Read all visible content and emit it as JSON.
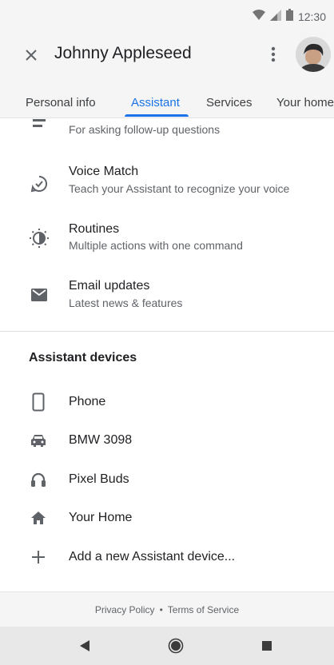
{
  "status_bar": {
    "time": "12:30",
    "icons": [
      "wifi-icon",
      "signal-icon",
      "battery-icon"
    ]
  },
  "header": {
    "title": "Johnny Appleseed",
    "close_icon": "close-icon",
    "menu_icon": "more-vert-icon"
  },
  "tabs": [
    {
      "label": "Personal info",
      "active": false
    },
    {
      "label": "Assistant",
      "active": true
    },
    {
      "label": "Services",
      "active": false
    },
    {
      "label": "Your home",
      "active": false
    }
  ],
  "settings": [
    {
      "title": "",
      "subtitle": "For asking follow-up questions",
      "icon": "conversation-icon"
    },
    {
      "title": "Voice Match",
      "subtitle": "Teach your Assistant to recognize your voice",
      "icon": "voice-match-icon"
    },
    {
      "title": "Routines",
      "subtitle": "Multiple actions with one command",
      "icon": "routines-icon"
    },
    {
      "title": "Email updates",
      "subtitle": "Latest news & features",
      "icon": "email-icon"
    }
  ],
  "devices": {
    "section_title": "Assistant devices",
    "items": [
      {
        "label": "Phone",
        "icon": "phone-icon"
      },
      {
        "label": "BMW 3098",
        "icon": "car-icon"
      },
      {
        "label": "Pixel Buds",
        "icon": "headphones-icon"
      },
      {
        "label": "Your Home",
        "icon": "home-icon"
      },
      {
        "label": "Add a new Assistant device...",
        "icon": "add-icon"
      }
    ]
  },
  "footer": {
    "privacy": "Privacy Policy",
    "separator": "•",
    "terms": "Terms of Service"
  },
  "colors": {
    "accent": "#1a73e8",
    "icon": "#5f6368",
    "text": "#202124"
  }
}
